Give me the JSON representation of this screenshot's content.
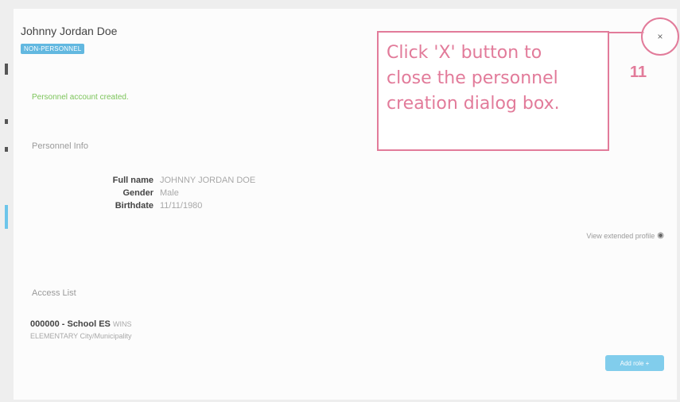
{
  "dialog": {
    "title": "Johnny Jordan Doe",
    "badge": "NON-PERSONNEL",
    "success_message": "Personnel account created.",
    "personnel_info_label": "Personnel Info",
    "fields": [
      {
        "key": "Full name",
        "value": "JOHNNY JORDAN DOE"
      },
      {
        "key": "Gender",
        "value": "Male"
      },
      {
        "key": "Birthdate",
        "value": "11/11/1980"
      }
    ],
    "view_profile_link": "View extended profile",
    "access_list_label": "Access List",
    "access": {
      "school": "000000 - School ES",
      "school_sub": "WINS",
      "school_desc": "ELEMENTARY City/Municipality"
    },
    "add_role_label": "Add role +",
    "close_label": "×"
  },
  "annotation": {
    "lines": [
      "Click 'X' button to",
      "close the personnel",
      "creation dialog box."
    ],
    "step": "11"
  },
  "colors": {
    "annotation": "#e27b9a",
    "badge": "#62b8e0",
    "success": "#7cc45a",
    "button": "#6cc5ea"
  }
}
